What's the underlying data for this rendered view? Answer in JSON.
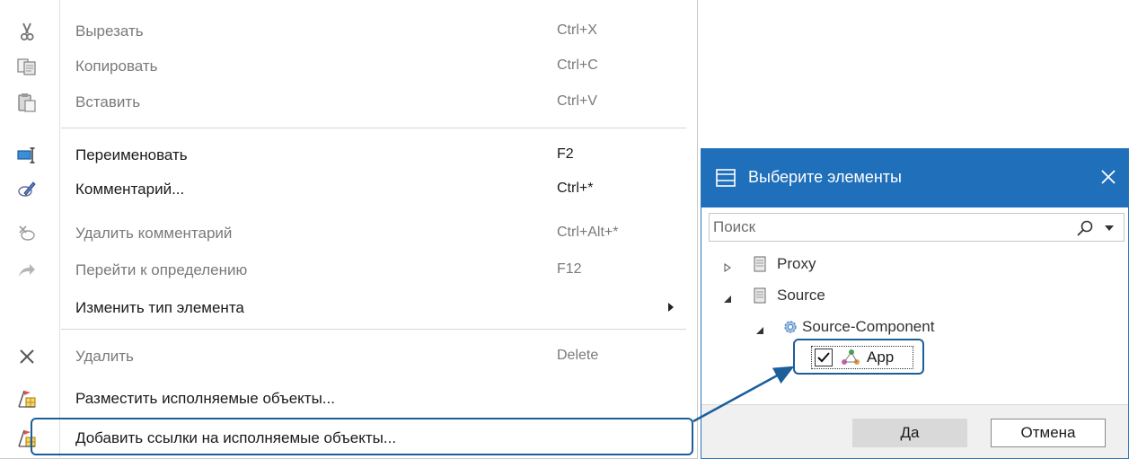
{
  "context_menu": {
    "items": [
      {
        "label": "Вырезать",
        "shortcut": "Ctrl+X",
        "icon": "scissors-icon",
        "enabled": false
      },
      {
        "label": "Копировать",
        "shortcut": "Ctrl+C",
        "icon": "copy-icon",
        "enabled": false
      },
      {
        "label": "Вставить",
        "shortcut": "Ctrl+V",
        "icon": "paste-icon",
        "enabled": false
      },
      {
        "label": "Переименовать",
        "shortcut": "F2",
        "icon": "rename-icon",
        "enabled": true
      },
      {
        "label": "Комментарий...",
        "shortcut": "Ctrl+*",
        "icon": "comment-pencil-icon",
        "enabled": true
      },
      {
        "label": "Удалить комментарий",
        "shortcut": "Ctrl+Alt+*",
        "icon": "remove-comment-icon",
        "enabled": false
      },
      {
        "label": "Перейти к определению",
        "shortcut": "F12",
        "icon": "goto-arrow-icon",
        "enabled": false
      },
      {
        "label": "Изменить тип элемента",
        "shortcut": "",
        "icon": "",
        "enabled": true,
        "submenu": true
      },
      {
        "label": "Удалить",
        "shortcut": "Delete",
        "icon": "delete-x-icon",
        "enabled": false
      },
      {
        "label": "Разместить исполняемые объекты...",
        "shortcut": "",
        "icon": "deploy-artifacts-icon",
        "enabled": true
      },
      {
        "label": "Добавить ссылки на исполняемые объекты...",
        "shortcut": "",
        "icon": "deploy-artifacts-icon",
        "enabled": true,
        "highlighted": true
      }
    ]
  },
  "dialog": {
    "title": "Выберите элементы",
    "search_placeholder": "Поиск",
    "tree": {
      "proxy": "Proxy",
      "source": "Source",
      "component": "Source-Component",
      "app": "App",
      "app_checked": true
    },
    "ok_label": "Да",
    "cancel_label": "Отмена"
  },
  "colors": {
    "accent": "#1f6fbb",
    "highlight_border": "#1c5e9a",
    "disabled_text": "#7a7a7a"
  }
}
